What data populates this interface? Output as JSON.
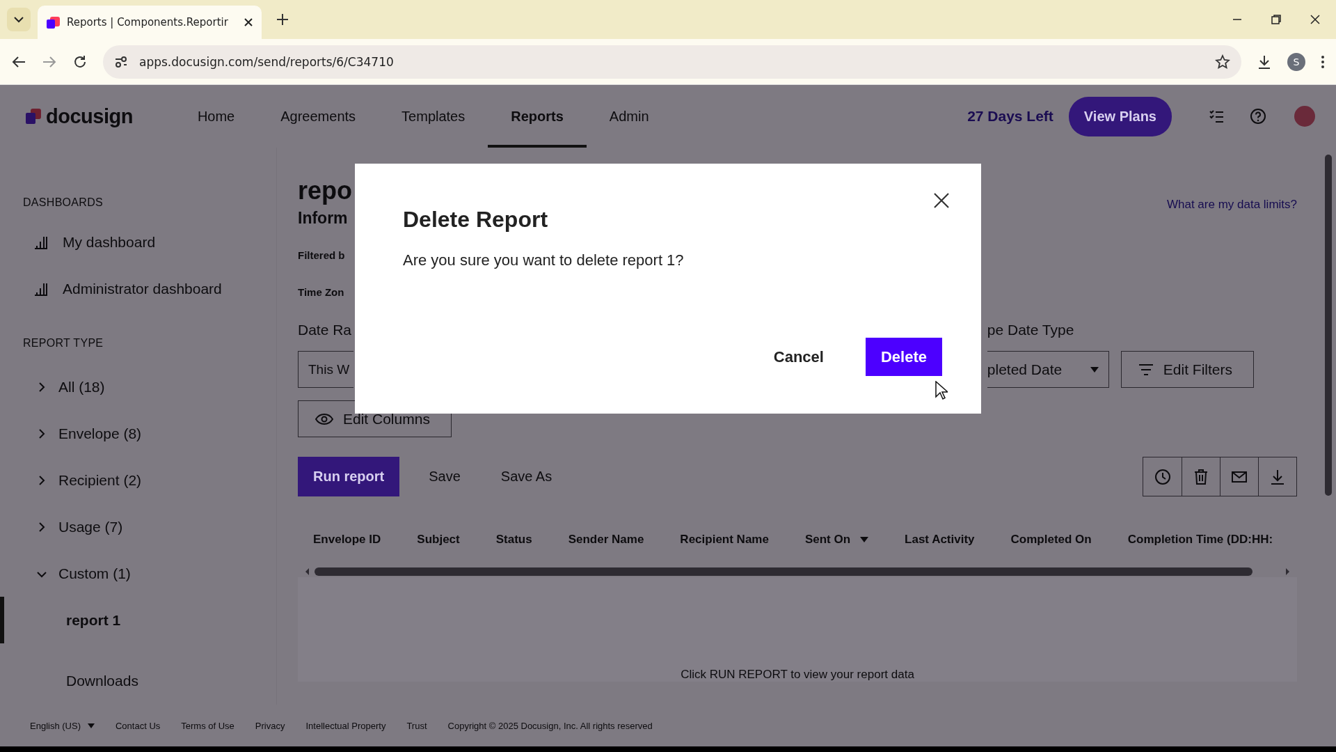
{
  "browser": {
    "tab_title": "Reports | Components.Reportir",
    "url": "apps.docusign.com/send/reports/6/C34710",
    "profile_initial": "S"
  },
  "app_header": {
    "logo": "docusign",
    "nav": [
      {
        "label": "Home",
        "selected": false
      },
      {
        "label": "Agreements",
        "selected": false
      },
      {
        "label": "Templates",
        "selected": false
      },
      {
        "label": "Reports",
        "selected": true
      },
      {
        "label": "Admin",
        "selected": false
      }
    ],
    "trial_text": "27 Days Left",
    "upgrade_button": "View Plans"
  },
  "sidebar": {
    "dashboards": {
      "heading": "DASHBOARDS",
      "items": [
        "My dashboard",
        "Administrator dashboard"
      ]
    },
    "report_types": {
      "heading": "REPORT TYPE",
      "items": [
        {
          "label": "All (18)",
          "expanded": false
        },
        {
          "label": "Envelope (8)",
          "expanded": false
        },
        {
          "label": "Recipient (2)",
          "expanded": false
        },
        {
          "label": "Usage (7)",
          "expanded": false
        },
        {
          "label": "Custom (1)",
          "expanded": true,
          "children": [
            {
              "label": "report 1",
              "selected": true
            }
          ]
        }
      ]
    },
    "downloads": "Downloads"
  },
  "main": {
    "title": "repo",
    "subtitle": "Inform",
    "filtered_label": "Filtered b",
    "timezone_label": "Time Zon",
    "data_limits_link": "What are my data limits?",
    "date_range": {
      "label": "Date Ra",
      "value": "This W"
    },
    "date_type": {
      "label": "pe Date Type",
      "value": "pleted Date"
    },
    "edit_filters_button": "Edit Filters",
    "edit_columns_button": "Edit Columns",
    "actions": [
      {
        "label": "Run report",
        "kind": "primary"
      },
      {
        "label": "Save",
        "kind": "text"
      },
      {
        "label": "Save As",
        "kind": "text"
      }
    ],
    "table": {
      "columns": [
        {
          "label": "Envelope ID",
          "sorted": false
        },
        {
          "label": "Subject",
          "sorted": false
        },
        {
          "label": "Status",
          "sorted": false
        },
        {
          "label": "Sender Name",
          "sorted": false
        },
        {
          "label": "Recipient Name",
          "sorted": false
        },
        {
          "label": "Sent On",
          "sorted": true
        },
        {
          "label": "Last Activity",
          "sorted": false
        },
        {
          "label": "Completed On",
          "sorted": false
        },
        {
          "label": "Completion Time (DD:HH:",
          "sorted": false
        }
      ],
      "empty_message": "Click RUN REPORT to view your report data"
    }
  },
  "footer": {
    "language": "English (US)",
    "links": [
      "Contact Us",
      "Terms of Use",
      "Privacy",
      "Intellectual Property",
      "Trust"
    ],
    "copyright": "Copyright © 2025 Docusign, Inc. All rights reserved"
  },
  "dialog": {
    "title": "Delete Report",
    "message": "Are you sure you want to delete report 1?",
    "buttons": [
      {
        "label": "Cancel",
        "kind": "secondary"
      },
      {
        "label": "Delete",
        "kind": "primary"
      }
    ]
  }
}
